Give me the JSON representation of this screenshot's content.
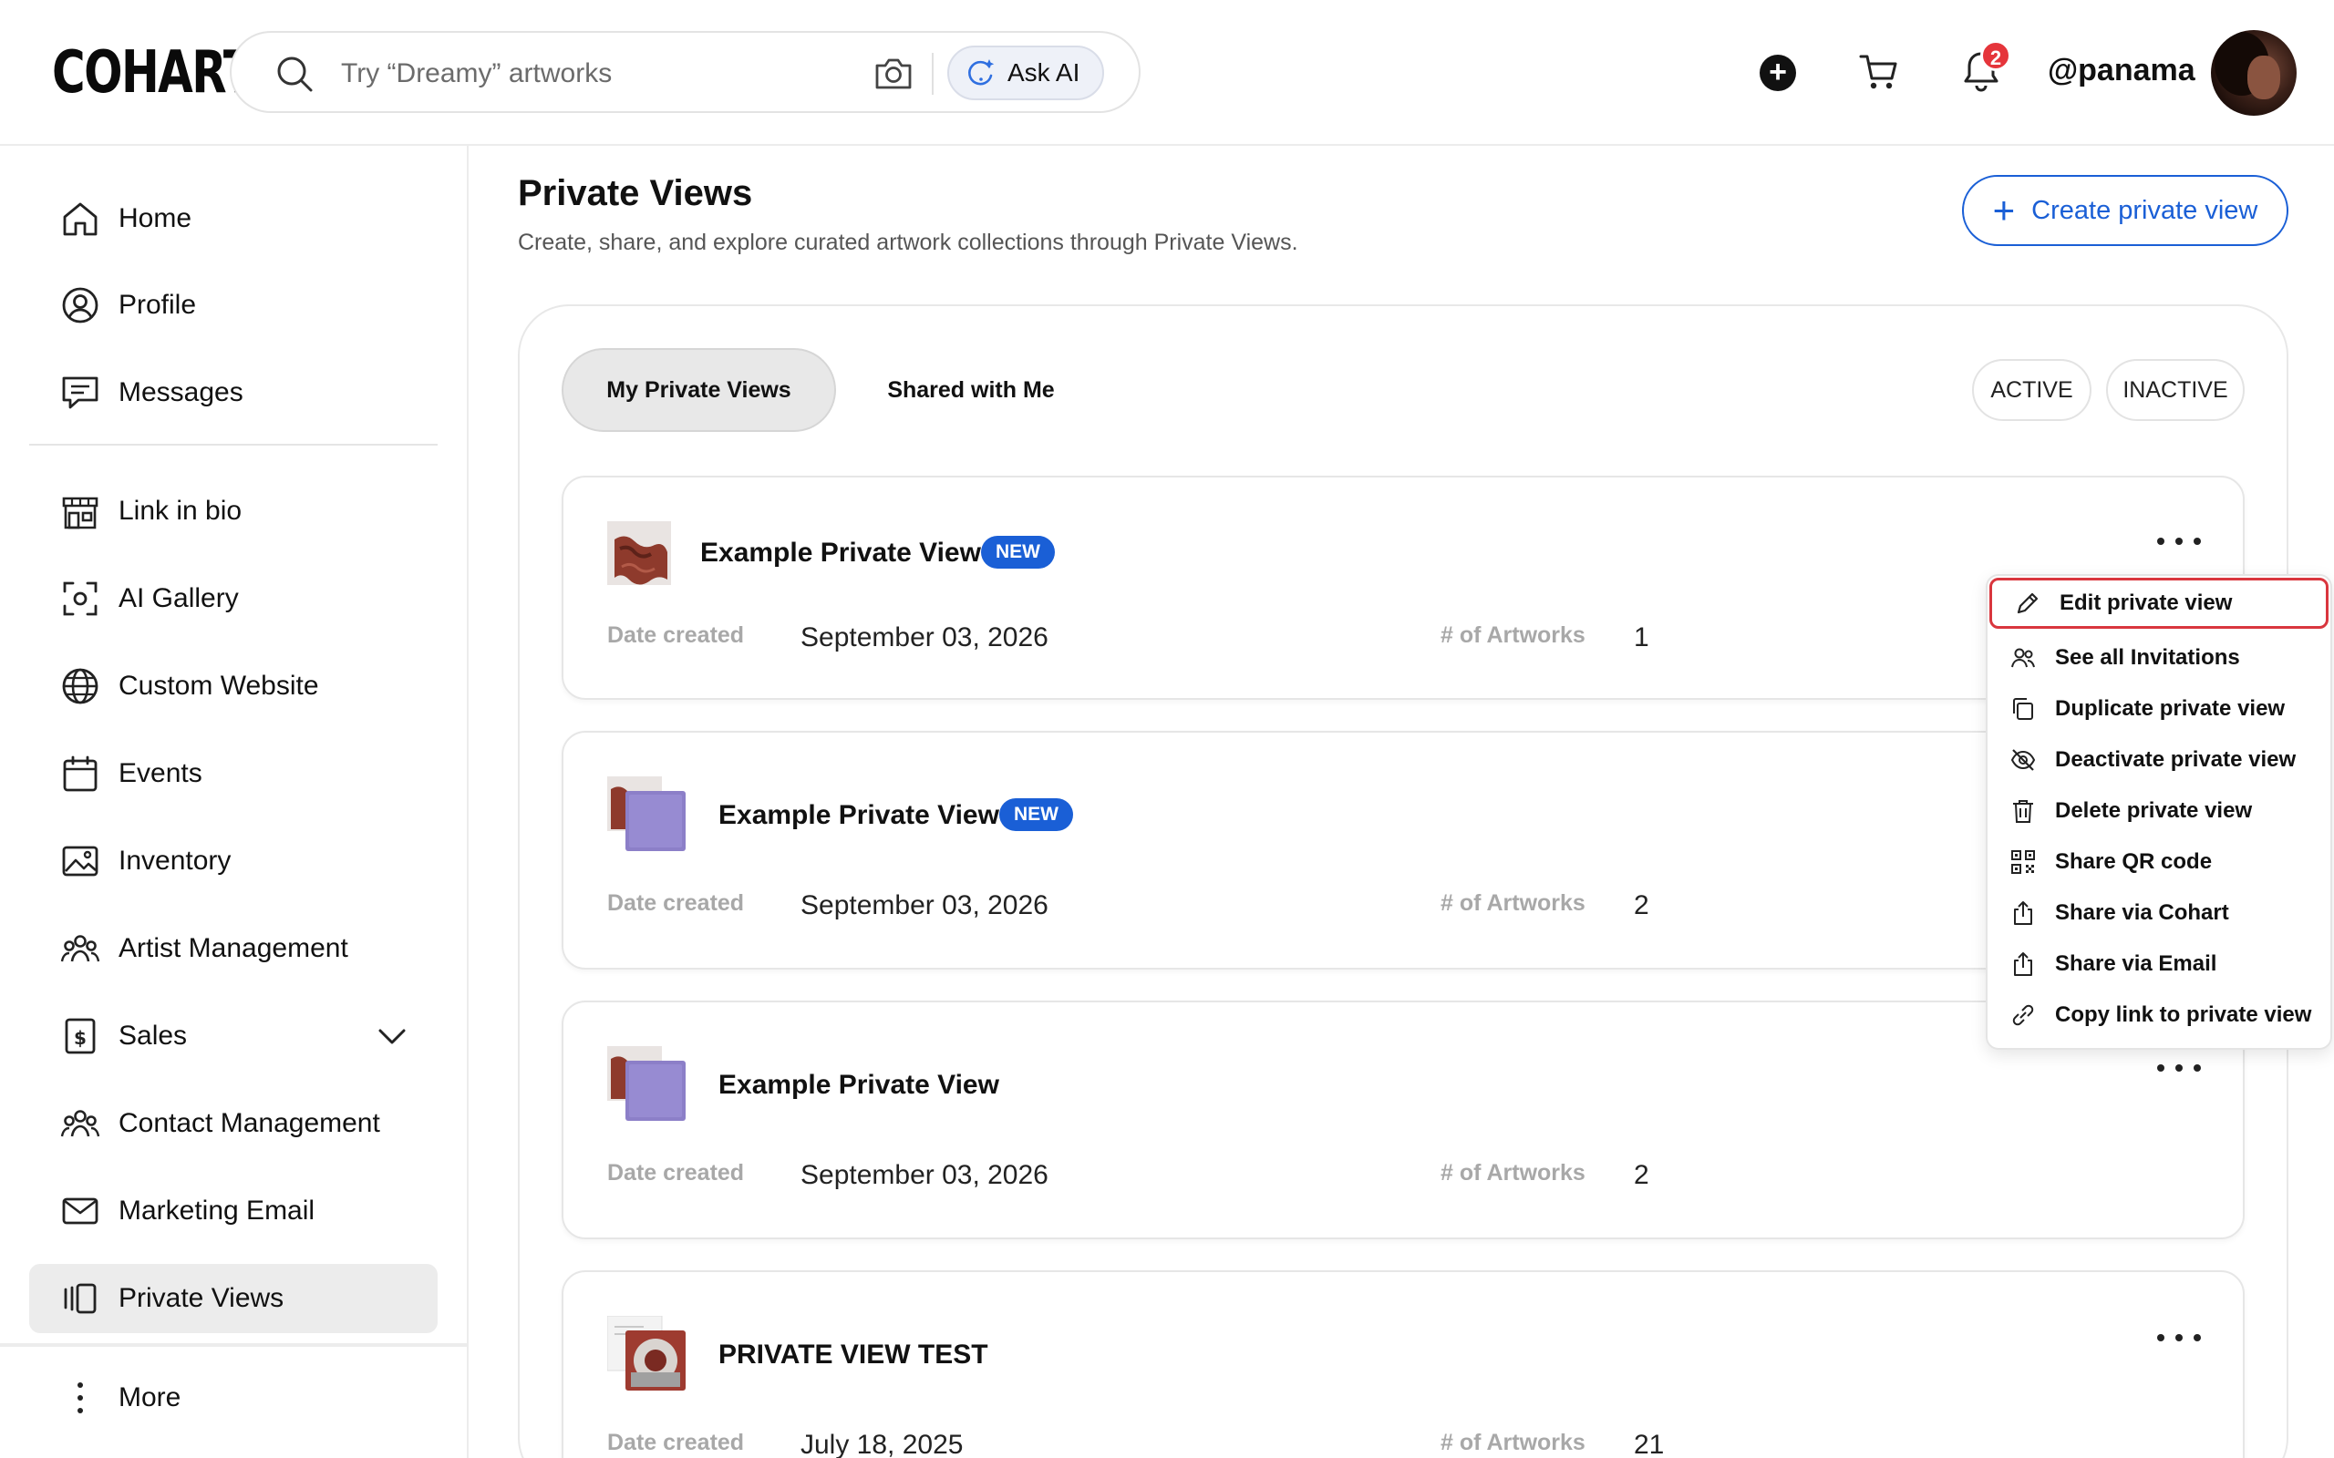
{
  "brand": {
    "logo": "COHART"
  },
  "search": {
    "placeholder": "Try “Dreamy” artworks",
    "ask_ai_label": "Ask AI"
  },
  "header": {
    "notification_count": "2",
    "username": "@panama"
  },
  "sidebar": {
    "items": [
      {
        "label": "Home"
      },
      {
        "label": "Profile"
      },
      {
        "label": "Messages"
      },
      {
        "label": "Link in bio"
      },
      {
        "label": "AI Gallery"
      },
      {
        "label": "Custom Website"
      },
      {
        "label": "Events"
      },
      {
        "label": "Inventory"
      },
      {
        "label": "Artist Management"
      },
      {
        "label": "Sales"
      },
      {
        "label": "Contact Management"
      },
      {
        "label": "Marketing Email"
      },
      {
        "label": "Private Views"
      }
    ],
    "more_label": "More"
  },
  "page": {
    "title": "Private Views",
    "subtitle": "Create, share, and explore curated artwork collections through Private Views.",
    "create_label": "Create private view"
  },
  "tabs": {
    "mine": "My Private Views",
    "shared": "Shared with Me"
  },
  "filters": {
    "active": "ACTIVE",
    "inactive": "INACTIVE"
  },
  "labels": {
    "date_created": "Date created",
    "artwork_count": "# of Artworks"
  },
  "views": [
    {
      "title": "Example Private View",
      "badge": "NEW",
      "date": "September 03, 2026",
      "count": "1"
    },
    {
      "title": "Example Private View",
      "badge": "NEW",
      "date": "September 03, 2026",
      "count": "2"
    },
    {
      "title": "Example Private View",
      "badge": "",
      "date": "September 03, 2026",
      "count": "2"
    },
    {
      "title": "PRIVATE VIEW TEST",
      "badge": "",
      "date": "July 18, 2025",
      "count": "21"
    }
  ],
  "menu": {
    "items": [
      {
        "label": "Edit private view",
        "icon": "pencil-icon"
      },
      {
        "label": "See all Invitations",
        "icon": "users-icon"
      },
      {
        "label": "Duplicate private view",
        "icon": "copy-icon"
      },
      {
        "label": "Deactivate private view",
        "icon": "eye-off-icon"
      },
      {
        "label": "Delete private view",
        "icon": "trash-icon"
      },
      {
        "label": "Share QR code",
        "icon": "qr-code-icon"
      },
      {
        "label": "Share via Cohart",
        "icon": "share-icon"
      },
      {
        "label": "Share via Email",
        "icon": "share-icon"
      },
      {
        "label": "Copy link to private view",
        "icon": "link-icon"
      }
    ]
  },
  "colors": {
    "accent": "#1a5fd6",
    "highlight": "#d9363e",
    "badge": "#e5353b"
  }
}
